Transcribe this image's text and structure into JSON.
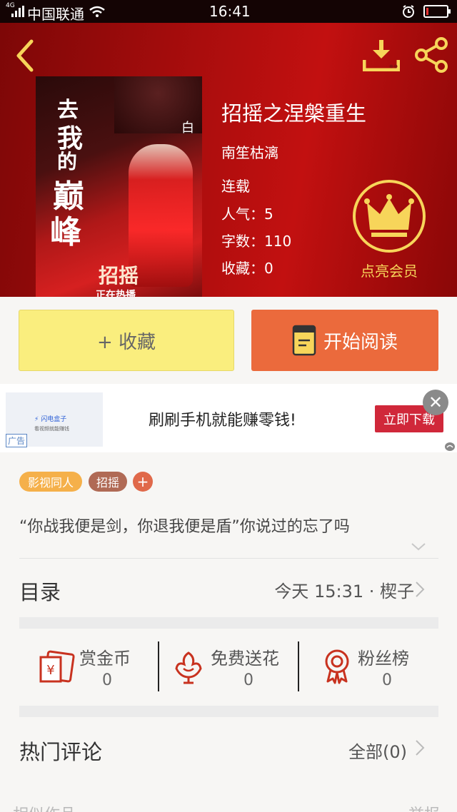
{
  "status_bar": {
    "network": "4G",
    "carrier": "中国联通",
    "time": "16:41"
  },
  "book": {
    "title": "招摇之涅槃重生",
    "author": "南笙枯漓",
    "status": "连载",
    "popularity_label": "人气：",
    "popularity": "5",
    "word_count_label": "字数：",
    "word_count": "110",
    "favorites_label": "收藏：",
    "favorites": "0",
    "cover": {
      "title_chars": [
        "去",
        "我",
        "的",
        "巅",
        "峰"
      ],
      "subtitle": "招摇",
      "small_text": "白",
      "bottom_text": "正在热播"
    }
  },
  "member": {
    "label": "点亮会员"
  },
  "actions": {
    "favorite_label": "+ 收藏",
    "read_label": "开始阅读"
  },
  "ad": {
    "brand": "闪电盒子",
    "brand_sub": "看视频就能赚钱",
    "badge": "广告",
    "text": "刷刷手机就能赚零钱!",
    "button": "立即下载"
  },
  "tags": [
    "影视同人",
    "招摇"
  ],
  "tag_add": "+",
  "intro": "“你战我便是剑，你退我便是盾”你说过的忘了吗",
  "toc": {
    "label": "目录",
    "update": "今天 15:31 · 楔子"
  },
  "stats": [
    {
      "label": "赏金币",
      "value": "0"
    },
    {
      "label": "免费送花",
      "value": "0"
    },
    {
      "label": "粉丝榜",
      "value": "0"
    }
  ],
  "comments": {
    "label": "热门评论",
    "all": "全部(0)"
  },
  "bottom": {
    "similar": "相似作品",
    "report": "举报"
  },
  "colors": {
    "hero_red": "#b40c0c",
    "gold": "#f7d55a",
    "favorite_bg": "#faee7e",
    "read_bg": "#eb6a3c",
    "tag_orange": "#f5b04a",
    "tag_brown": "#b06a55",
    "tag_add": "#e0694a",
    "icon_red": "#c8321f",
    "ad_button": "#d0283a"
  }
}
